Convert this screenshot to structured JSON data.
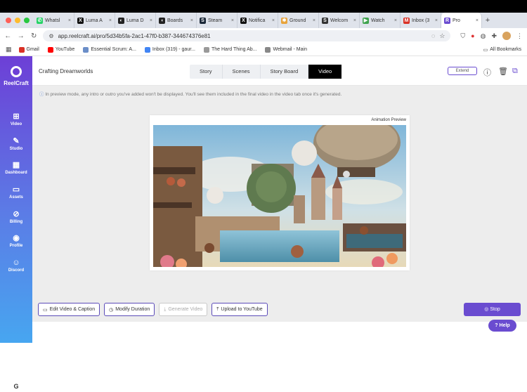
{
  "browser": {
    "tabs": [
      {
        "label": "Whatsl",
        "color": "#25d366",
        "glyph": "✆"
      },
      {
        "label": "Luma A",
        "color": "#111111",
        "glyph": "X"
      },
      {
        "label": "Luma D",
        "color": "#222222",
        "glyph": "◐"
      },
      {
        "label": "Boards",
        "color": "#222222",
        "glyph": "◖"
      },
      {
        "label": "Steam",
        "color": "#1b2838",
        "glyph": "S"
      },
      {
        "label": "Notifica",
        "color": "#111111",
        "glyph": "X"
      },
      {
        "label": "Ground",
        "color": "#e8a33a",
        "glyph": "✱"
      },
      {
        "label": "Welcom",
        "color": "#333333",
        "glyph": "S"
      },
      {
        "label": "Watch",
        "color": "#3fa34d",
        "glyph": "▶"
      },
      {
        "label": "Inbox (3",
        "color": "#d93025",
        "glyph": "M"
      },
      {
        "label": "Pro",
        "color": "#6a4cd0",
        "glyph": "R"
      }
    ],
    "new_tab": "+",
    "url": "app.reelcraft.ai/pro/5d34b5fa-2ac1-47f0-b387-344674376e81",
    "nav": {
      "back": "←",
      "forward": "→",
      "reload": "↻"
    },
    "bookmarks": [
      {
        "label": "Gmail",
        "color": "#d93025"
      },
      {
        "label": "YouTube",
        "color": "#ff0000"
      },
      {
        "label": "Essential Scrum: A...",
        "color": "#6b8ec8"
      },
      {
        "label": "Inbox (319) - gaur...",
        "color": "#4285f4"
      },
      {
        "label": "The Hard Thing Ab...",
        "color": "#999999"
      },
      {
        "label": "Webmail - Main",
        "color": "#888888"
      }
    ],
    "all_bookmarks": "All Bookmarks"
  },
  "sidebar": {
    "brand": "ReelCraft",
    "items": [
      {
        "label": "Video",
        "icon": "⊞"
      },
      {
        "label": "Studio",
        "icon": "✎"
      },
      {
        "label": "Dashboard",
        "icon": "▦"
      },
      {
        "label": "Assets",
        "icon": "▭"
      },
      {
        "label": "Billing",
        "icon": "⊘"
      },
      {
        "label": "Profile",
        "icon": "◉"
      },
      {
        "label": "Discord",
        "icon": "☺"
      }
    ],
    "account_initial": "G"
  },
  "header": {
    "project_title": "Crafting Dreamworlds",
    "tabs": [
      "Story",
      "Scenes",
      "Story Board",
      "Video"
    ],
    "active_tab": "Video",
    "extend_label": "Extend"
  },
  "notice": "In preview mode, any intro or outro you've added won't be displayed. You'll see them included in the final video in the video tab once it's generated.",
  "preview": {
    "caption": "Animation Preview"
  },
  "actions": {
    "edit": "Edit Video & Caption",
    "modify": "Modify Duration",
    "generate": "Generate Video",
    "upload": "Upload to YouTube",
    "stop": "Stop",
    "help": "Help"
  },
  "colors": {
    "accent": "#6a4cd0",
    "sidebar_top": "#6d3fd6",
    "sidebar_bottom": "#47a6f0"
  }
}
